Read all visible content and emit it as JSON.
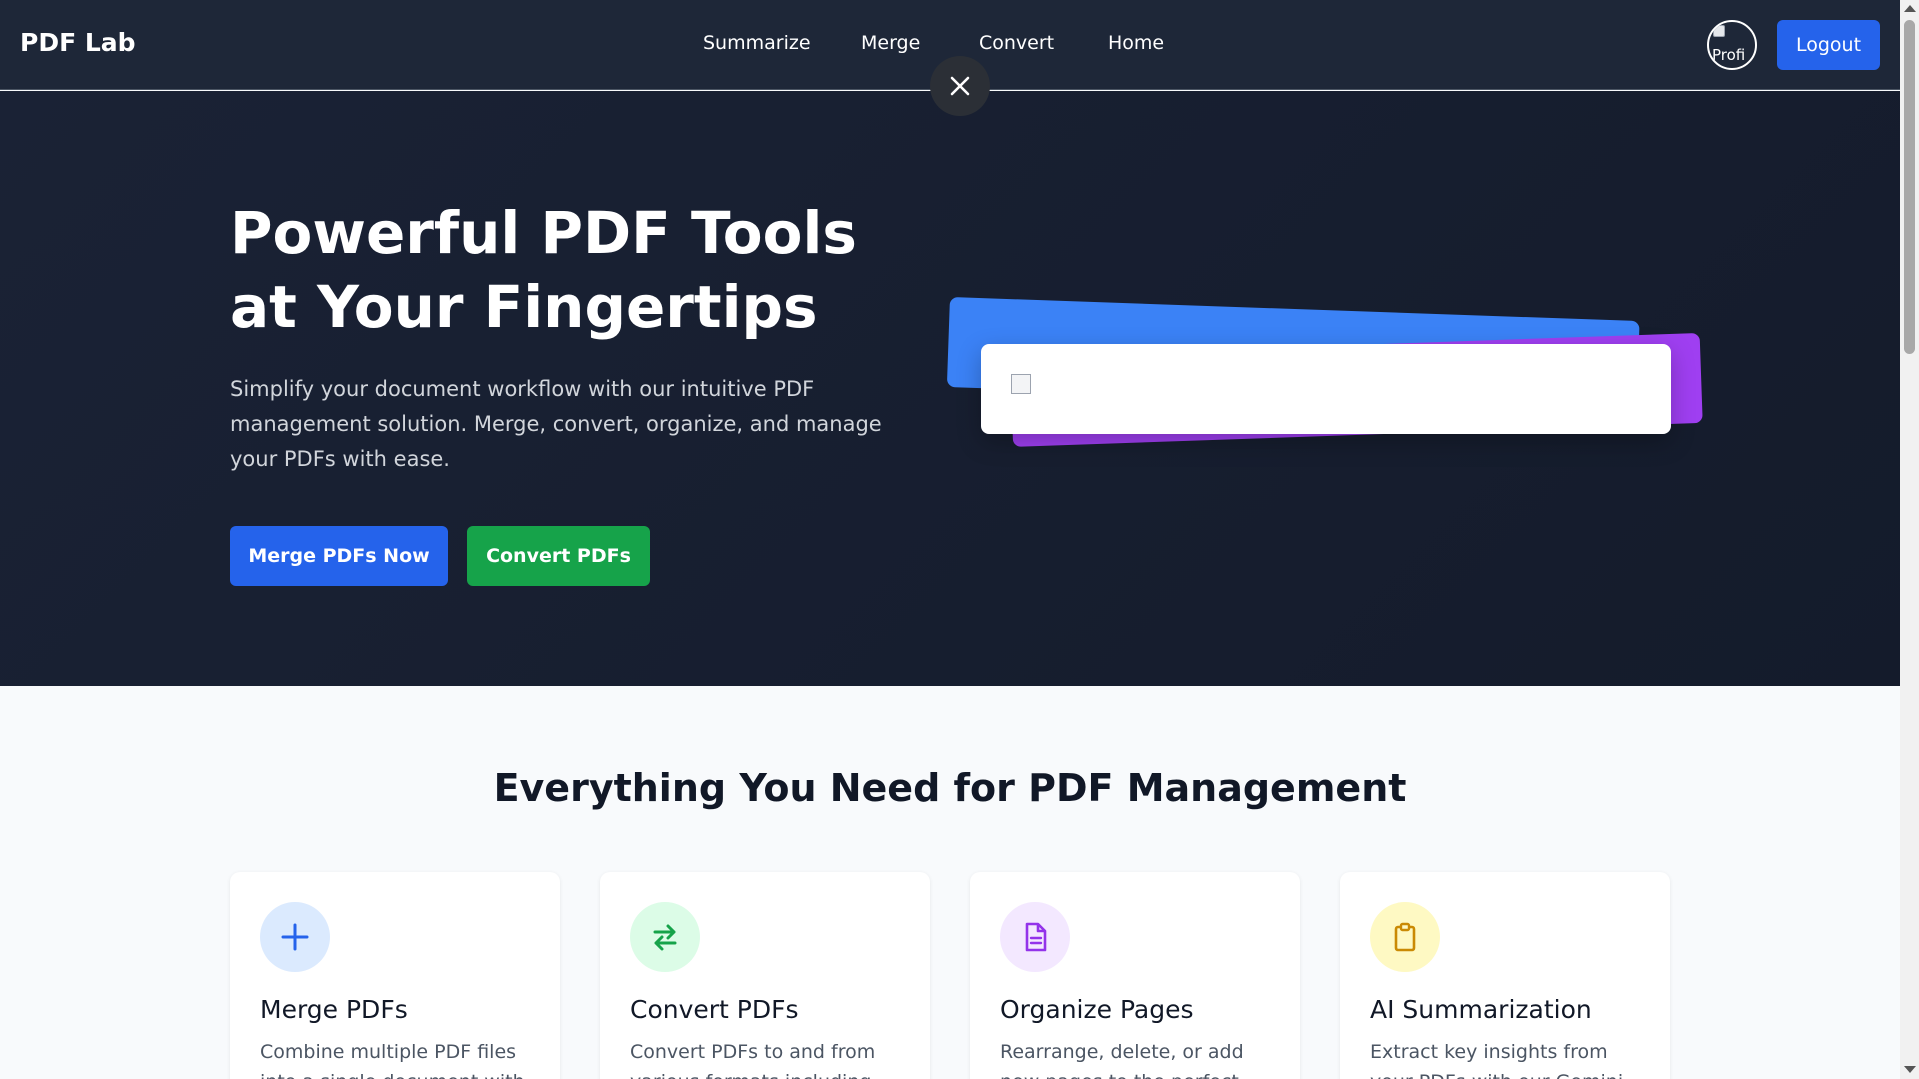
{
  "nav": {
    "brand": "PDF Lab",
    "links": [
      "Summarize",
      "Merge",
      "Convert",
      "Home"
    ],
    "avatar_alt": "Profi",
    "logout_label": "Logout"
  },
  "hero": {
    "title": "Powerful PDF Tools at Your Fingertips",
    "description": "Simplify your document workflow with our intuitive PDF management solution. Merge, convert, organize, and manage your PDFs with ease.",
    "merge_button": "Merge PDFs Now",
    "convert_button": "Convert PDFs"
  },
  "features": {
    "title": "Everything You Need for PDF Management",
    "cards": [
      {
        "title": "Merge PDFs",
        "description": "Combine multiple PDF files into a single document with",
        "icon": "plus-icon",
        "color": "#2563eb",
        "bg": "#dbeafe"
      },
      {
        "title": "Convert PDFs",
        "description": "Convert PDFs to and from various formats including",
        "icon": "arrows-exchange-icon",
        "color": "#16a34a",
        "bg": "#dcfce7"
      },
      {
        "title": "Organize Pages",
        "description": "Rearrange, delete, or add new pages to the perfect",
        "icon": "document-icon",
        "color": "#9333ea",
        "bg": "#f3e8ff"
      },
      {
        "title": "AI Summarization",
        "description": "Extract key insights from your PDFs with our Gemini",
        "icon": "clipboard-icon",
        "color": "#ca8a04",
        "bg": "#fef9c3"
      }
    ]
  },
  "colors": {
    "nav_bg": "#1e2738",
    "primary": "#2563eb",
    "success": "#16a34a",
    "accent_purple": "#9f3ff1"
  }
}
